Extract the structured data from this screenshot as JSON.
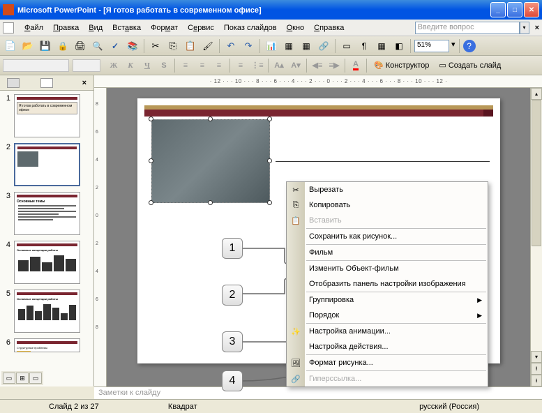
{
  "titlebar": {
    "app_name": "Microsoft PowerPoint",
    "doc_title": "[Я готов работать в современном офисе]"
  },
  "menubar": {
    "items": [
      "Файл",
      "Правка",
      "Вид",
      "Вставка",
      "Формат",
      "Сервис",
      "Показ слайдов",
      "Окно",
      "Справка"
    ],
    "help_placeholder": "Введите вопрос"
  },
  "toolbar1": {
    "zoom": "51%"
  },
  "toolbar2": {
    "designer": "Конструктор",
    "new_slide": "Создать слайд"
  },
  "rulers": {
    "horizontal": "· 12 · · · 10 · · · 8 · · · 6 · · · 4 · · · 2 · · · 0 · · · 2 · · · 4 · · · 6 · · · 8 · · · 10 · · · 12 ·",
    "vertical_marks": [
      "8",
      "6",
      "4",
      "2",
      "0",
      "2",
      "4",
      "6",
      "8"
    ]
  },
  "thumbnails": {
    "items": [
      {
        "num": "1",
        "title": "Я готов работать в современном офисе"
      },
      {
        "num": "2",
        "title": ""
      },
      {
        "num": "3",
        "title": "Основные темы"
      },
      {
        "num": "4",
        "title": "Основные концепции работы"
      },
      {
        "num": "5",
        "title": "Основные концепции работы"
      },
      {
        "num": "6",
        "title": "Структурные проблемы"
      }
    ],
    "active_index": 1
  },
  "context_menu": {
    "items": [
      {
        "label": "Вырезать",
        "icon": "✂"
      },
      {
        "label": "Копировать",
        "icon": "⎘"
      },
      {
        "label": "Вставить",
        "icon": "📋",
        "disabled": true
      },
      {
        "sep": true
      },
      {
        "label": "Сохранить как рисунок..."
      },
      {
        "sep": true
      },
      {
        "label": "Фильм"
      },
      {
        "sep": true
      },
      {
        "label": "Изменить Объект-фильм"
      },
      {
        "label": "Отобразить панель настройки изображения"
      },
      {
        "sep": true
      },
      {
        "label": "Группировка",
        "submenu": true
      },
      {
        "label": "Порядок",
        "submenu": true
      },
      {
        "sep": true
      },
      {
        "label": "Настройка анимации...",
        "icon": "✨"
      },
      {
        "label": "Настройка действия..."
      },
      {
        "sep": true
      },
      {
        "label": "Формат рисунка...",
        "icon": "🖼"
      },
      {
        "sep": true
      },
      {
        "label": "Гиперссылка...",
        "icon": "🔗",
        "disabled": true
      }
    ]
  },
  "callouts": [
    "1",
    "2",
    "3",
    "4"
  ],
  "notes": {
    "placeholder": "Заметки к слайду"
  },
  "statusbar": {
    "slide_info": "Слайд 2 из 27",
    "shape": "Квадрат",
    "lang": "русский (Россия)"
  }
}
